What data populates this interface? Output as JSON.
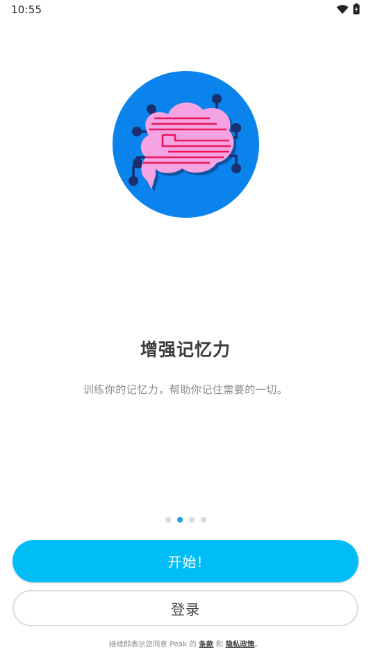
{
  "status_bar": {
    "time": "10:55",
    "icons": [
      "wifi-icon",
      "battery-icon"
    ]
  },
  "hero": {
    "icon": "brain-circuit-illustration",
    "colors": {
      "circle": "#0a84ec",
      "brain": "#f6a3e3",
      "lines": "#e8175d",
      "circuit": "#1a2f6e"
    }
  },
  "onboarding": {
    "title": "增强记忆力",
    "subtitle": "训练你的记忆力，帮助你记住需要的一切。",
    "page_count": 4,
    "active_page": 2
  },
  "buttons": {
    "start_label": "开始!",
    "login_label": "登录"
  },
  "footer": {
    "prefix": "继续即表示您同意 Peak 的 ",
    "terms_label": "条款",
    "and": " 和 ",
    "privacy_label": "隐私政策",
    "suffix": "。"
  },
  "colors": {
    "accent": "#00bdf7",
    "active_dot": "#1aa3e0",
    "inactive_dot": "#d9d9d9"
  }
}
